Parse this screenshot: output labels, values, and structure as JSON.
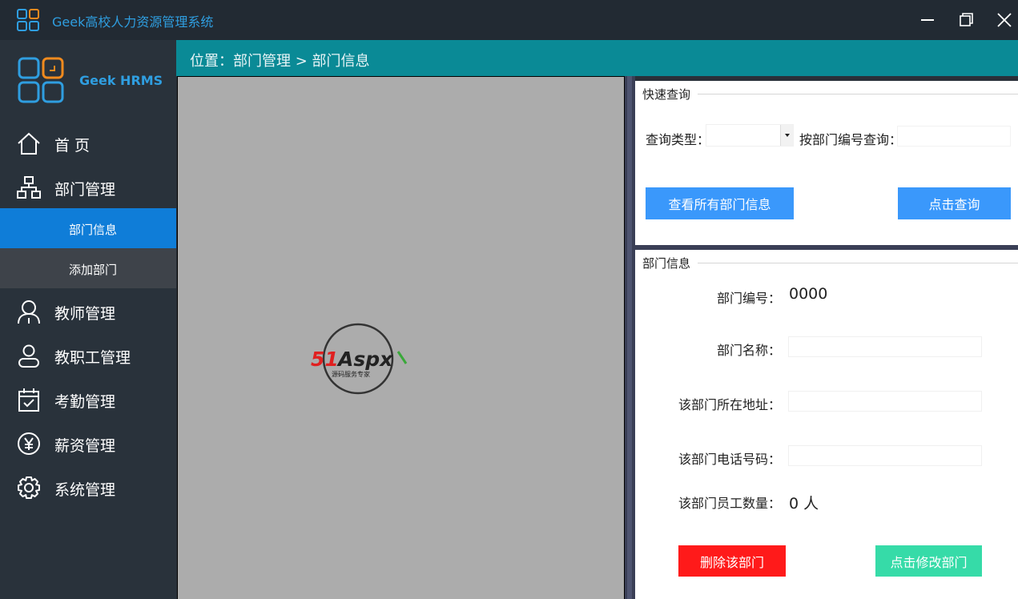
{
  "window": {
    "title": "Geek高校人力资源管理系统"
  },
  "brand": {
    "name": "Geek HRMS"
  },
  "nav": {
    "items": [
      {
        "label": "首 页",
        "icon": "home-icon"
      },
      {
        "label": "部门管理",
        "icon": "org-chart-icon"
      },
      {
        "label": "教师管理",
        "icon": "teacher-icon"
      },
      {
        "label": "教职工管理",
        "icon": "staff-icon"
      },
      {
        "label": "考勤管理",
        "icon": "calendar-check-icon"
      },
      {
        "label": "薪资管理",
        "icon": "yen-icon"
      },
      {
        "label": "系统管理",
        "icon": "gear-icon"
      }
    ],
    "sub_items": [
      {
        "label": "部门信息",
        "active": true
      },
      {
        "label": "添加部门",
        "active": false
      }
    ]
  },
  "breadcrumb": {
    "text": "位置：部门管理 > 部门信息"
  },
  "image_panel": {
    "watermark_text": "51Aspx",
    "watermark_sub": "源码服务专家"
  },
  "quick_query": {
    "legend": "快速查询",
    "type_label": "查询类型：",
    "type_value": "",
    "dept_no_label": "按部门编号查询：",
    "dept_no_value": "",
    "view_all_button": "查看所有部门信息",
    "query_button": "点击查询"
  },
  "dept_info": {
    "legend": "部门信息",
    "dept_no_label": "部门编号：",
    "dept_no_value": "0000",
    "dept_name_label": "部门名称：",
    "dept_name_value": "",
    "address_label": "该部门所在地址：",
    "address_value": "",
    "phone_label": "该部门电话号码：",
    "phone_value": "",
    "staff_count_label": "该部门员工数量：",
    "staff_count_value": "0 人",
    "delete_button": "删除该部门",
    "modify_button": "点击修改部门"
  },
  "colors": {
    "accent_blue": "#0f7dd8",
    "breadcrumb_teal": "#0a8a96",
    "button_blue": "#3a98fb",
    "button_red": "#ff1a1a",
    "button_teal": "#36dba8",
    "logo_orange": "#f08a1e"
  }
}
